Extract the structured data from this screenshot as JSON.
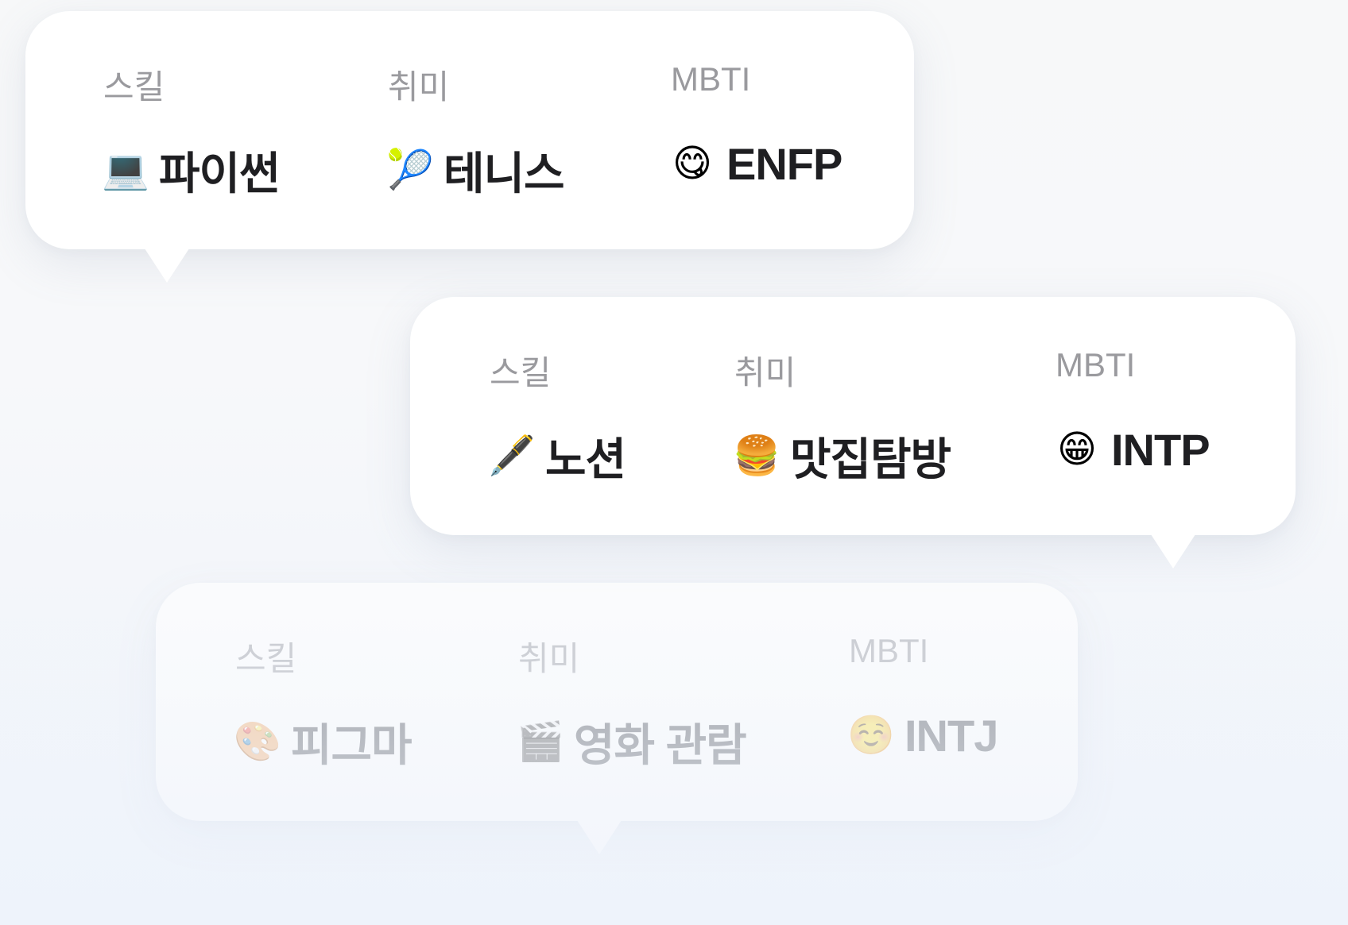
{
  "cards": [
    {
      "skill_label": "스킬",
      "hobby_label": "취미",
      "mbti_label": "MBTI",
      "skill": {
        "icon": "laptop-emoji",
        "glyph": "💻",
        "text": "파이썬"
      },
      "hobby": {
        "icon": "tennis-ball-emoji",
        "glyph": "🎾",
        "text": "테니스"
      },
      "mbti": {
        "icon": "yum-face-emoji",
        "glyph": "😋",
        "text": "ENFP"
      }
    },
    {
      "skill_label": "스킬",
      "hobby_label": "취미",
      "mbti_label": "MBTI",
      "skill": {
        "icon": "fountain-pen-emoji",
        "glyph": "🖋️",
        "text": "노션"
      },
      "hobby": {
        "icon": "hamburger-emoji",
        "glyph": "🍔",
        "text": "맛집탐방"
      },
      "mbti": {
        "icon": "grinning-face-emoji",
        "glyph": "😁",
        "text": "INTP"
      }
    },
    {
      "skill_label": "스킬",
      "hobby_label": "취미",
      "mbti_label": "MBTI",
      "skill": {
        "icon": "palette-emoji",
        "glyph": "🎨",
        "text": "피그마"
      },
      "hobby": {
        "icon": "clapper-board-emoji",
        "glyph": "🎬",
        "text": "영화 관람"
      },
      "mbti": {
        "icon": "smiling-face-emoji",
        "glyph": "☺️",
        "text": "INTJ"
      }
    }
  ]
}
